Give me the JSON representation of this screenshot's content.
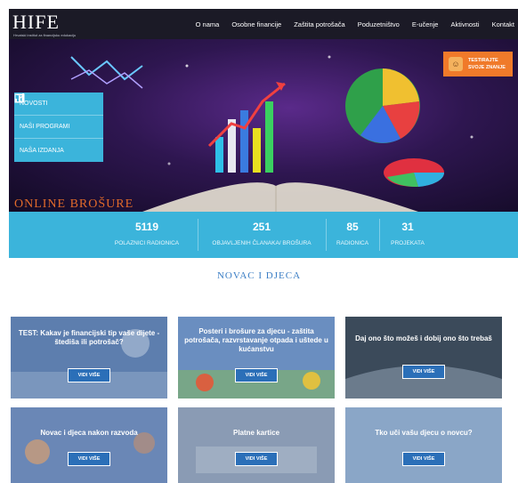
{
  "header": {
    "logo": "HIFE",
    "logo_subtitle": "Hrvatski institut za financijsku edukaciju",
    "nav": [
      "O nama",
      "Osobne financije",
      "Zaštita potrošača",
      "Poduzetništvo",
      "E-učenje",
      "Aktivnosti",
      "Kontakt"
    ]
  },
  "hero": {
    "side_menu": [
      {
        "label": "NOVOSTI",
        "icon": "edit-icon"
      },
      {
        "label": "NAŠI PROGRAMI",
        "icon": "chart-icon"
      },
      {
        "label": "NAŠA IZDANJA",
        "icon": "book-icon"
      }
    ],
    "quiz_button": {
      "line1": "TESTIRAJTE",
      "line2": "SVOJE ZNANJE"
    },
    "caption": "ONLINE BROŠURE"
  },
  "stats": [
    {
      "value": "5119",
      "label": "POLAZNICI RADIONICA"
    },
    {
      "value": "251",
      "label": "OBJAVLJENIH ČLANAKA/ BROŠURA"
    },
    {
      "value": "85",
      "label": "RADIONICA"
    },
    {
      "value": "31",
      "label": "PROJEKATA"
    }
  ],
  "section": {
    "title": "NOVAC I DJECA"
  },
  "cards": [
    {
      "title": "TEST: Kakav je financijski tip vaše dijete - štediša ili potrošač?",
      "button": "VIDI VIŠE"
    },
    {
      "title": "Posteri i brošure za djecu - zaštita potrošača, razvrstavanje otpada i uštede u kućanstvu",
      "button": "VIDI VIŠE"
    },
    {
      "title": "Daj ono što možeš i dobij ono što trebaš",
      "button": "VIDI VIŠE"
    },
    {
      "title": "Novac i djeca nakon razvoda",
      "button": "VIDI VIŠE"
    },
    {
      "title": "Platne kartice",
      "button": "VIDI VIŠE"
    },
    {
      "title": "Tko uči vašu djecu o novcu?",
      "button": "VIDI VIŠE"
    }
  ],
  "colors": {
    "accent": "#3bb4db",
    "header_bg": "#1b1a26",
    "orange": "#f07a2a",
    "title_blue": "#3b7ec5"
  }
}
